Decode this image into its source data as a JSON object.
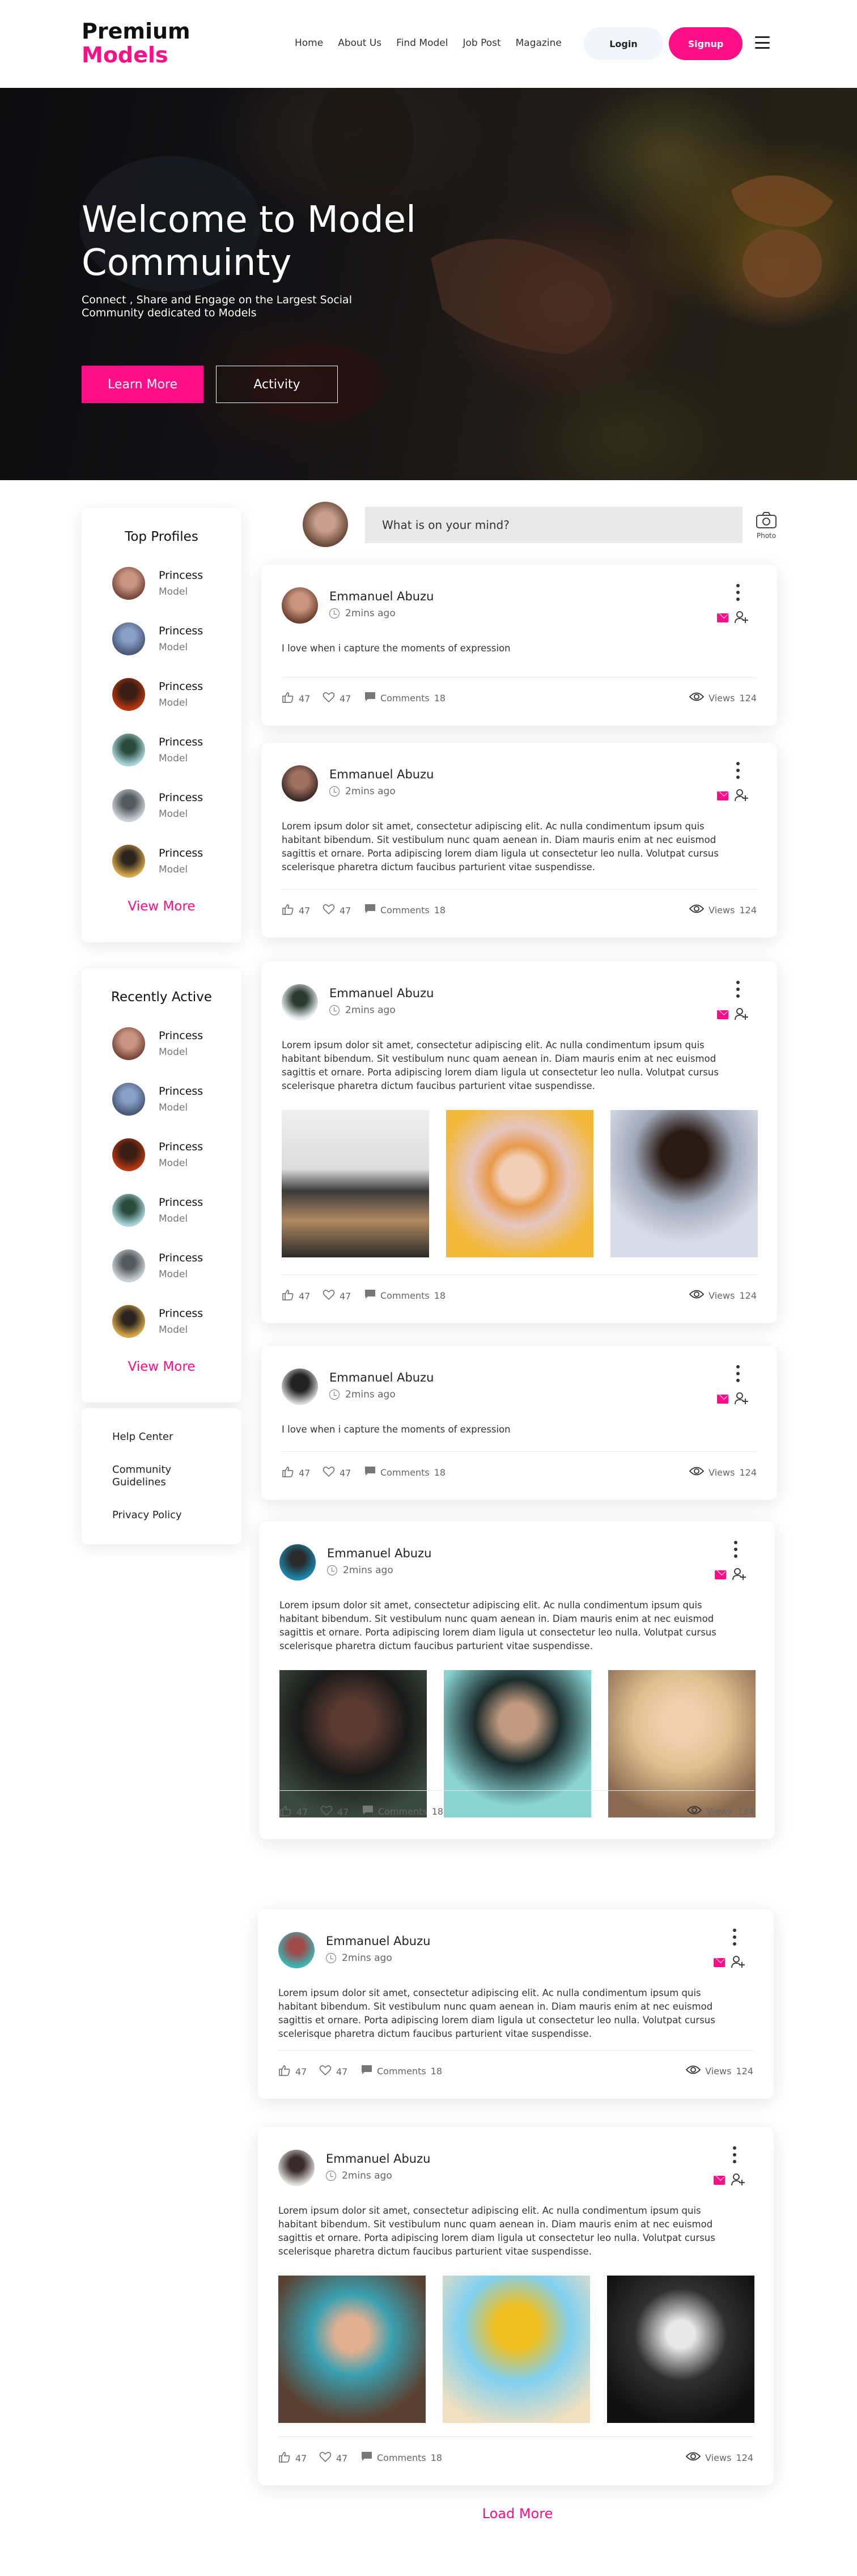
{
  "brand": {
    "line1": "Premium",
    "line2": "Models"
  },
  "nav": {
    "links": [
      "Home",
      "About Us",
      "Find Model",
      "Job Post",
      "Magazine"
    ],
    "login": "Login",
    "signup": "Signup"
  },
  "hero": {
    "title": "Welcome to Model Commuinty",
    "subtitle": "Connect , Share and Engage on the Largest Social Community dedicated to Models",
    "learn_more": "Learn More",
    "activity": "Activity"
  },
  "top_profiles": {
    "title": "Top Profiles",
    "items": [
      {
        "name": "Princess",
        "role": "Model"
      },
      {
        "name": "Princess",
        "role": "Model"
      },
      {
        "name": "Princess",
        "role": "Model"
      },
      {
        "name": "Princess",
        "role": "Model"
      },
      {
        "name": "Princess",
        "role": "Model"
      },
      {
        "name": "Princess",
        "role": "Model"
      }
    ],
    "view_more": "View More"
  },
  "recently_active": {
    "title": "Recently Active",
    "items": [
      {
        "name": "Princess",
        "role": "Model"
      },
      {
        "name": "Princess",
        "role": "Model"
      },
      {
        "name": "Princess",
        "role": "Model"
      },
      {
        "name": "Princess",
        "role": "Model"
      },
      {
        "name": "Princess",
        "role": "Model"
      },
      {
        "name": "Princess",
        "role": "Model"
      }
    ],
    "view_more": "View More"
  },
  "footer_links": [
    "Help Center",
    "Community Guidelines",
    "Privacy Policy"
  ],
  "composer": {
    "placeholder": "What is on your mind?",
    "photo_label": "Photo"
  },
  "posts": [
    {
      "author": "Emmanuel Abuzu",
      "time": "2mins ago",
      "text": "I love when i capture the moments of expression",
      "likes": "47",
      "hearts": "47",
      "comments_label": "Comments",
      "comments": "18",
      "views_label": "Views",
      "views": "124"
    },
    {
      "author": "Emmanuel Abuzu",
      "time": "2mins ago",
      "text": "Lorem ipsum dolor sit amet, consectetur adipiscing elit. Ac nulla condimentum ipsum quis habitant bibendum. Sit vestibulum nunc quam aenean in. Diam mauris enim at nec euismod sagittis et ornare. Porta adipiscing lorem diam ligula ut consectetur leo nulla. Volutpat cursus scelerisque pharetra dictum faucibus parturient vitae suspendisse.",
      "likes": "47",
      "hearts": "47",
      "comments_label": "Comments",
      "comments": "18",
      "views_label": "Views",
      "views": "124"
    },
    {
      "author": "Emmanuel Abuzu",
      "time": "2mins ago",
      "text": "Lorem ipsum dolor sit amet, consectetur adipiscing elit. Ac nulla condimentum ipsum quis habitant bibendum. Sit vestibulum nunc quam aenean in. Diam mauris enim at nec euismod sagittis et ornare. Porta adipiscing lorem diam ligula ut consectetur leo nulla. Volutpat cursus scelerisque pharetra dictum faucibus parturient vitae suspendisse.",
      "likes": "47",
      "hearts": "47",
      "comments_label": "Comments",
      "comments": "18",
      "views_label": "Views",
      "views": "124"
    },
    {
      "author": "Emmanuel Abuzu",
      "time": "2mins ago",
      "text": "I love when i capture the moments of expression",
      "likes": "47",
      "hearts": "47",
      "comments_label": "Comments",
      "comments": "18",
      "views_label": "Views",
      "views": "124"
    },
    {
      "author": "Emmanuel Abuzu",
      "time": "2mins ago",
      "text": "Lorem ipsum dolor sit amet, consectetur adipiscing elit. Ac nulla condimentum ipsum quis habitant bibendum. Sit vestibulum nunc quam aenean in. Diam mauris enim at nec euismod sagittis et ornare. Porta adipiscing lorem diam ligula ut consectetur leo nulla. Volutpat cursus scelerisque pharetra dictum faucibus parturient vitae suspendisse.",
      "likes": "47",
      "hearts": "47",
      "comments_label": "Comments",
      "comments": "18",
      "views_label": "Views",
      "views": "124"
    },
    {
      "author": "Emmanuel Abuzu",
      "time": "2mins ago",
      "text": "Lorem ipsum dolor sit amet, consectetur adipiscing elit. Ac nulla condimentum ipsum quis habitant bibendum. Sit vestibulum nunc quam aenean in. Diam mauris enim at nec euismod sagittis et ornare. Porta adipiscing lorem diam ligula ut consectetur leo nulla. Volutpat cursus scelerisque pharetra dictum faucibus parturient vitae suspendisse.",
      "likes": "47",
      "hearts": "47",
      "comments_label": "Comments",
      "comments": "18",
      "views_label": "Views",
      "views": "124"
    },
    {
      "author": "Emmanuel Abuzu",
      "time": "2mins ago",
      "text": "Lorem ipsum dolor sit amet, consectetur adipiscing elit. Ac nulla condimentum ipsum quis habitant bibendum. Sit vestibulum nunc quam aenean in. Diam mauris enim at nec euismod sagittis et ornare. Porta adipiscing lorem diam ligula ut consectetur leo nulla. Volutpat cursus scelerisque pharetra dictum faucibus parturient vitae suspendisse.",
      "likes": "47",
      "hearts": "47",
      "comments_label": "Comments",
      "comments": "18",
      "views_label": "Views",
      "views": "124"
    }
  ],
  "load_more": "Load More",
  "colors": {
    "accent": "#ff0f87",
    "text": "#222222",
    "muted": "#777777",
    "login_bg": "#f2f5fa",
    "input_bg": "#e9e9e9"
  }
}
